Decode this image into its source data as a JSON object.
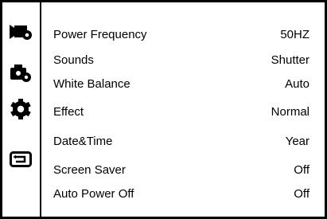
{
  "sidebar": {
    "icons": [
      "video-camera-icon",
      "photo-camera-settings-icon",
      "gear-icon",
      "back-icon"
    ],
    "selected_index": 2
  },
  "settings": {
    "items": [
      {
        "label": "Power Frequency",
        "value": "50HZ"
      },
      {
        "label": "Sounds",
        "value": "Shutter"
      },
      {
        "label": "White Balance",
        "value": "Auto"
      },
      {
        "label": "Effect",
        "value": "Normal"
      },
      {
        "label": "Date&Time",
        "value": "Year"
      },
      {
        "label": "Screen Saver",
        "value": "Off"
      },
      {
        "label": "Auto Power Off",
        "value": "Off"
      }
    ]
  }
}
